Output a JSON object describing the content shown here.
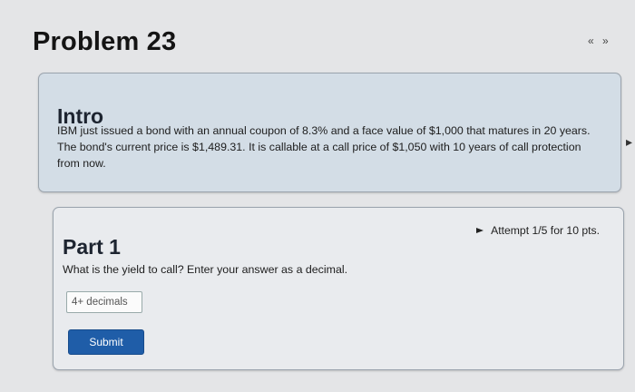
{
  "header": {
    "title": "Problem 23",
    "prev_arrow": "«",
    "next_arrow": "»"
  },
  "side_arrow": "▸",
  "intro": {
    "heading": "Intro",
    "text": "IBM just issued a bond with an annual coupon of 8.3% and a face value of $1,000 that matures in 20 years. The bond's current price is $1,489.31. It is callable at a call price of $1,050 with 10 years of call protection from now."
  },
  "part1": {
    "heading": "Part 1",
    "attempt": "Attempt 1/5 for 10 pts.",
    "question": "What is the yield to call? Enter your answer as a decimal.",
    "input_placeholder": "4+ decimals",
    "input_value": "",
    "submit_label": "Submit"
  },
  "colors": {
    "intro_bg": "#d3dde6",
    "part_bg": "#e9ebee",
    "submit_bg": "#1f5da8"
  }
}
